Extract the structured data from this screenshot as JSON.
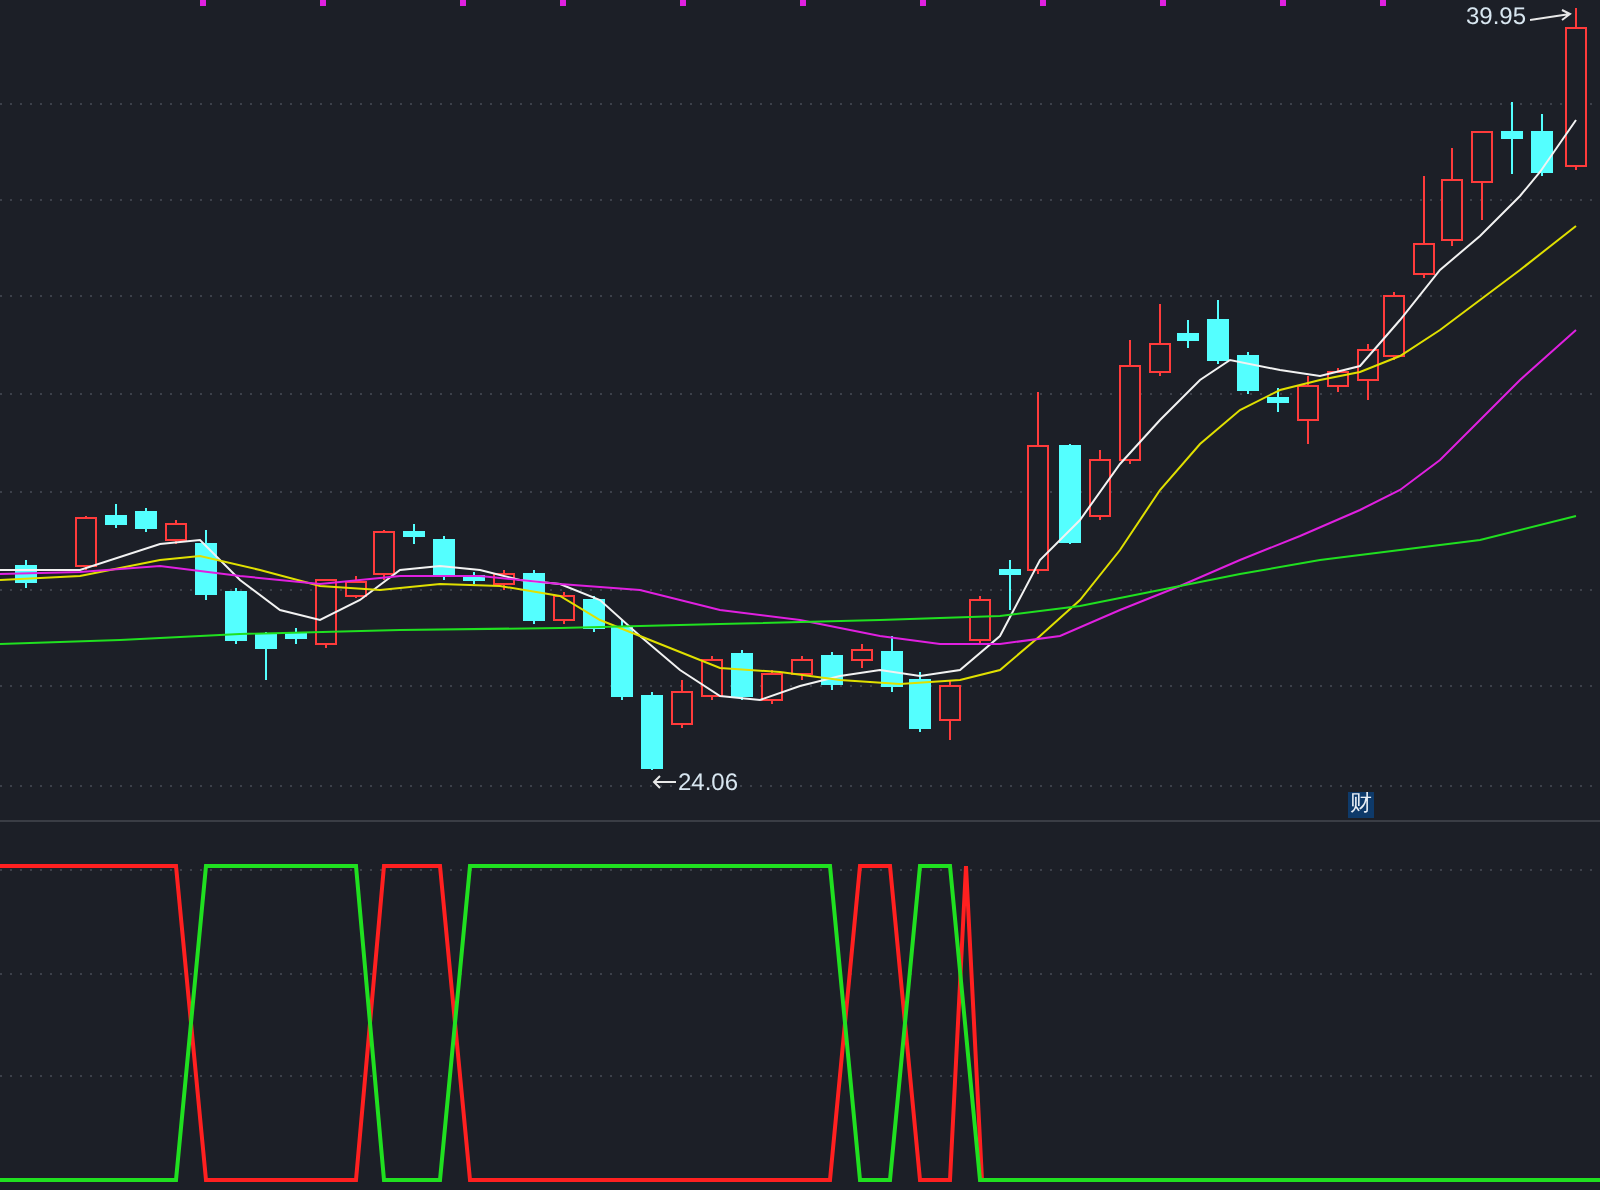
{
  "price_chart": {
    "high_label": "39.95",
    "low_label": "24.06",
    "badge": "财"
  }
}
